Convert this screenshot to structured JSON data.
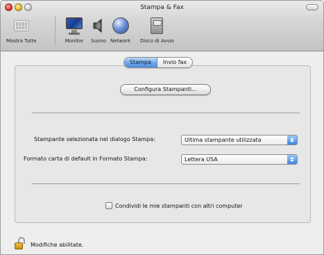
{
  "window": {
    "title": "Stampa & Fax"
  },
  "toolbar": {
    "items": [
      {
        "label": "Mostra Tutte",
        "icon": "show-all-icon"
      },
      {
        "label": "Monitor",
        "icon": "monitor-icon"
      },
      {
        "label": "Suono",
        "icon": "speaker-icon"
      },
      {
        "label": "Network",
        "icon": "network-globe-icon"
      },
      {
        "label": "Disco di Avvio",
        "icon": "startup-disk-icon"
      }
    ]
  },
  "tabs": [
    {
      "label": "Stampa",
      "active": true
    },
    {
      "label": "Invio fax",
      "active": false
    }
  ],
  "configure_button": "Configura Stampanti...",
  "printer_row": {
    "label": "Stampante selezionata nel dialogo Stampa:",
    "value": "Ultima stampante utilizzata"
  },
  "paper_row": {
    "label": "Formato carta di default in Formato Stampa:",
    "value": "Lettera USA"
  },
  "share_checkbox": {
    "label": "Condividi le mie stampanti con altri computer",
    "checked": false
  },
  "lock": {
    "label": "Modifiche abilitate.",
    "icon": "lock-open-icon"
  },
  "colors": {
    "accent": "#4e8ee0",
    "window_bg": "#eeeeee"
  }
}
